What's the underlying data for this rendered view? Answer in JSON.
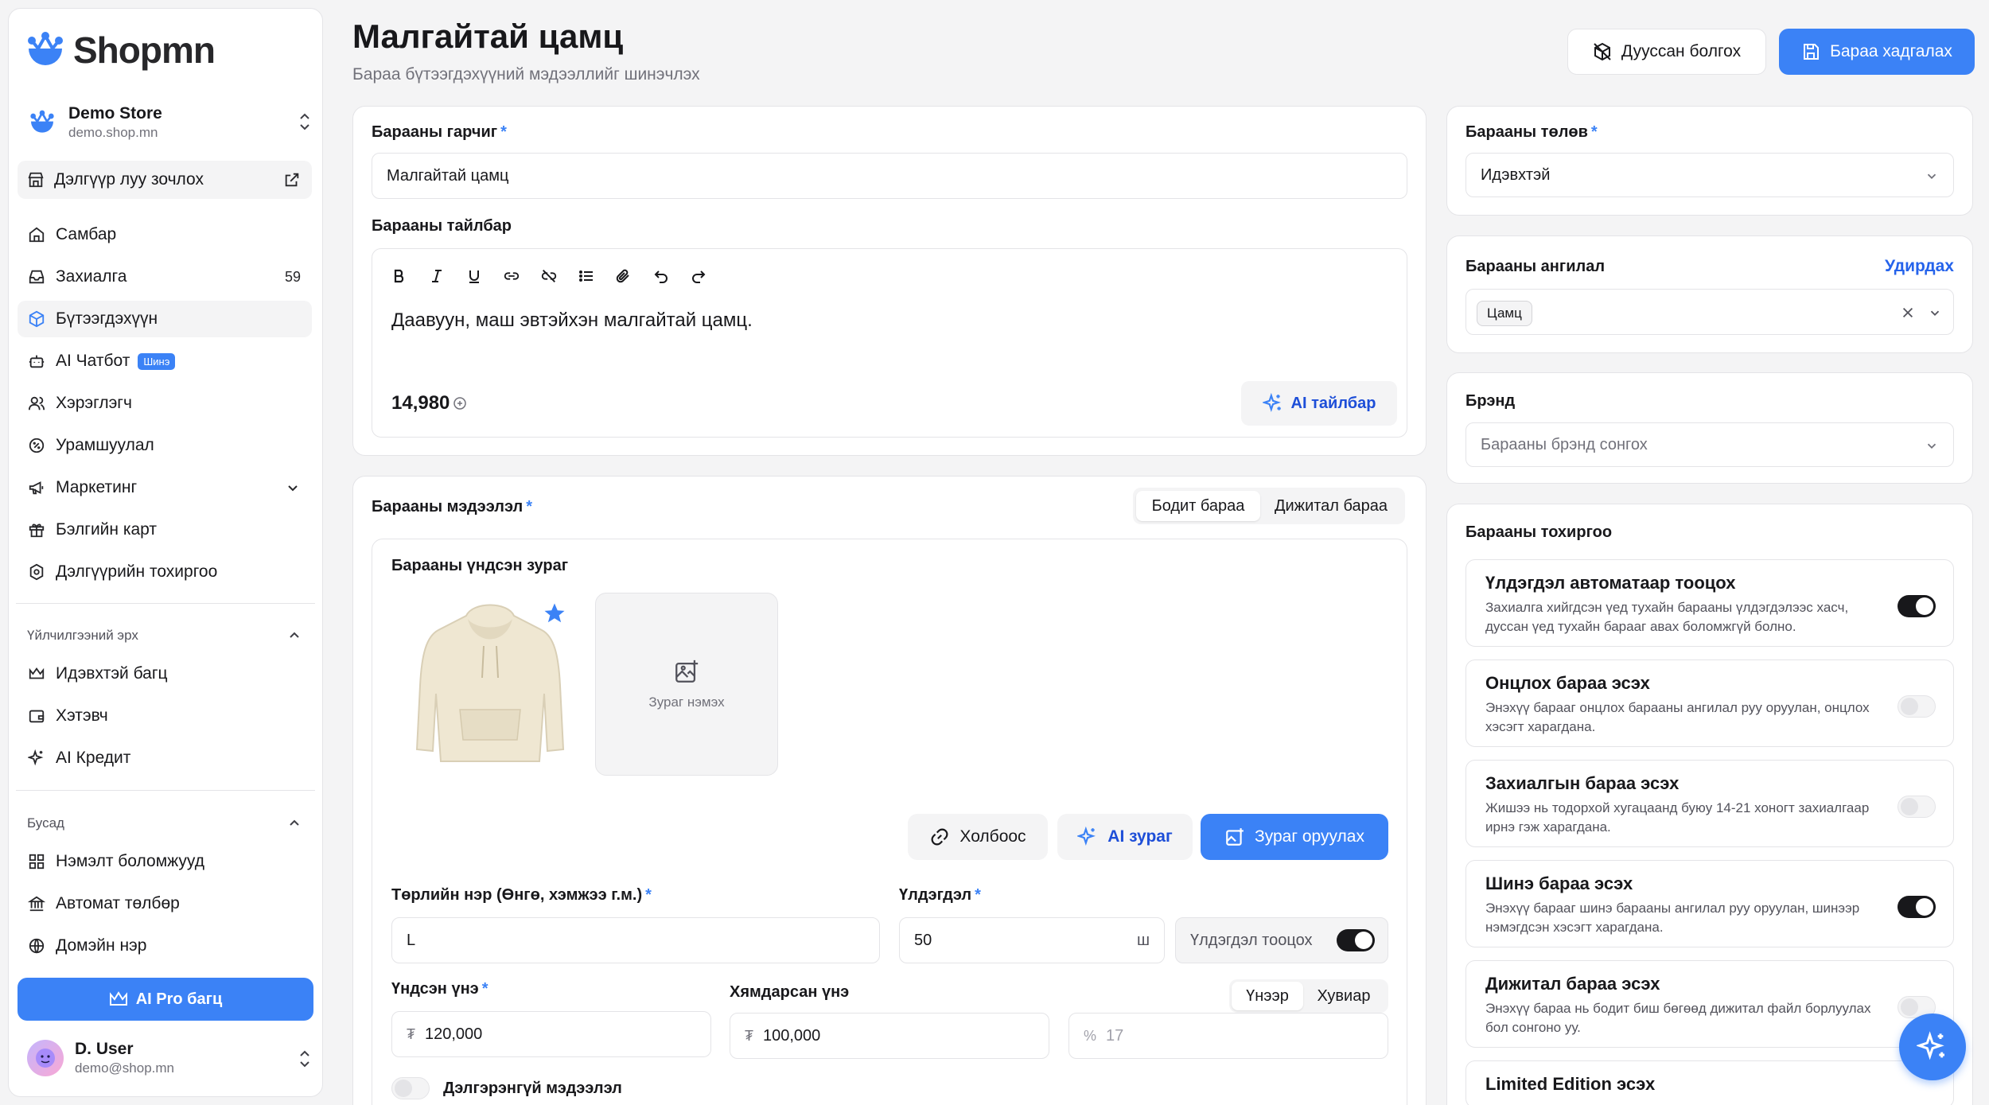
{
  "brand": {
    "name": "Shopmn",
    "accent": "#3b82f6"
  },
  "store": {
    "name": "Demo Store",
    "domain": "demo.shop.mn"
  },
  "sidebar": {
    "visit_store": "Дэлгүүр луу зочлох",
    "items": [
      {
        "label": "Самбар",
        "icon": "home-icon"
      },
      {
        "label": "Захиалга",
        "icon": "inbox-icon",
        "count": "59"
      },
      {
        "label": "Бүтээгдэхүүн",
        "icon": "box-icon"
      },
      {
        "label": "AI Чатбот",
        "icon": "bot-icon",
        "badge": "Шинэ"
      },
      {
        "label": "Хэрэглэгч",
        "icon": "users-icon"
      },
      {
        "label": "Урамшуулал",
        "icon": "discount-icon"
      },
      {
        "label": "Маркетинг",
        "icon": "megaphone-icon"
      },
      {
        "label": "Бэлгийн карт",
        "icon": "gift-icon"
      },
      {
        "label": "Дэлгүүрийн тохиргоо",
        "icon": "settings-icon"
      }
    ],
    "plan_section": "Үйлчилгээний эрх",
    "plan_items": [
      {
        "label": "Идэвхтэй багц",
        "icon": "crown-icon"
      },
      {
        "label": "Хэтэвч",
        "icon": "wallet-icon"
      },
      {
        "label": "AI Кредит",
        "icon": "sparkle-icon"
      }
    ],
    "other_section": "Бусад",
    "other_items": [
      {
        "label": "Нэмэлт боломжууд",
        "icon": "grid-icon"
      },
      {
        "label": "Автомат төлбөр",
        "icon": "bank-icon"
      },
      {
        "label": "Домэйн нэр",
        "icon": "globe-icon"
      }
    ],
    "pro_button": "AI Pro багц",
    "user": {
      "name": "D. User",
      "email": "demo@shop.mn"
    }
  },
  "header": {
    "title": "Малгайтай цамц",
    "subtitle": "Бараа бүтээгдэхүүний мэдээллийг шинэчлэх",
    "btn_out_of_stock": "Дууссан болгох",
    "btn_save": "Бараа хадгалах"
  },
  "basic": {
    "title_label": "Барааны гарчиг",
    "title_value": "Малгайтай цамц",
    "desc_label": "Барааны тайлбар",
    "desc_value": "Даавуун, маш эвтэйхэн малгайтай цамц.",
    "price_display": "14,980",
    "ai_desc_button": "AI тайлбар"
  },
  "info": {
    "label": "Барааны мэдээлэл",
    "tab_physical": "Бодит бараа",
    "tab_digital": "Дижитал бараа",
    "main_image_label": "Барааны үндсэн зураг",
    "add_image": "Зураг нэмэх",
    "btn_link": "Холбоос",
    "btn_ai_image": "AI зураг",
    "btn_upload": "Зураг оруулах",
    "variant_label": "Төрлийн нэр (Өнгө, хэмжээ г.м.)",
    "variant_value": "L",
    "stock_label": "Үлдэгдэл",
    "stock_value": "50",
    "stock_unit": "ш",
    "stock_toggle": "Үлдэгдэл тооцох",
    "base_price_label": "Үндсэн үнэ",
    "base_price_value": "120,000",
    "discount_label": "Хямдарсан үнэ",
    "discount_value": "100,000",
    "seg_price": "Үнээр",
    "seg_percent": "Хувиар",
    "percent_placeholder": "17",
    "currency_symbol": "₮",
    "percent_symbol": "%",
    "detail_toggle": "Дэлгэрэнгүй мэдээлэл"
  },
  "right": {
    "status_label": "Барааны төлөв",
    "status_value": "Идэвхтэй",
    "category_label": "Барааны ангилал",
    "category_manage": "Удирдах",
    "category_chip": "Цамц",
    "brand_label": "Брэнд",
    "brand_placeholder": "Барааны брэнд сонгох",
    "settings_label": "Барааны тохиргоо",
    "options": [
      {
        "title": "Үлдэгдэл автоматаар тооцох",
        "desc": "Захиалга хийгдсэн үед тухайн барааны үлдэгдэлээс хасч, дуссан үед тухайн барааг авах боломжгүй болно.",
        "on": true
      },
      {
        "title": "Онцлох бараа эсэх",
        "desc": "Энэхүү барааг онцлох барааны ангилал руу оруулан, онцлох хэсэгт харагдана.",
        "on": false
      },
      {
        "title": "Захиалгын бараа эсэх",
        "desc": "Жишээ нь тодорхой хугацаанд буюу 14-21 хоногт захиалгаар ирнэ гэж харагдана.",
        "on": false
      },
      {
        "title": "Шинэ бараа эсэх",
        "desc": "Энэхүү барааг шинэ барааны ангилал руу оруулан, шинээр нэмэгдсэн хэсэгт харагдана.",
        "on": true
      },
      {
        "title": "Дижитал бараа эсэх",
        "desc": "Энэхүү бараа нь бодит биш бөгөөд дижитал файл борлуулах бол сонгоно уу.",
        "on": false
      },
      {
        "title": "Limited Edition эсэх",
        "desc": "",
        "on": false
      }
    ]
  }
}
